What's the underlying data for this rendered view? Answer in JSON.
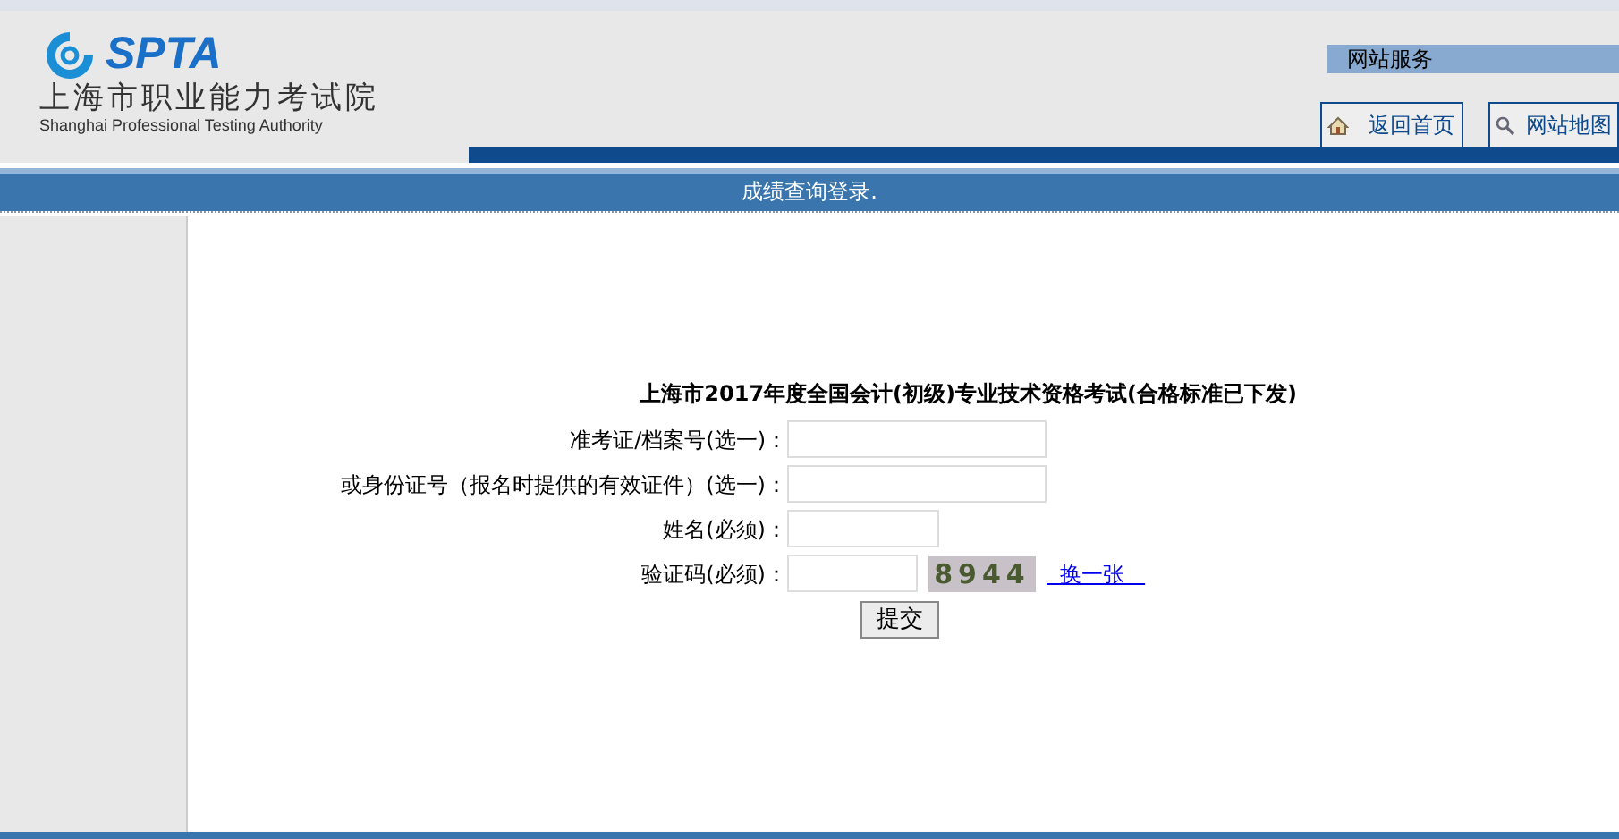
{
  "logo": {
    "mark": "SPTA",
    "name": "上海市职业能力考试院",
    "english": "Shanghai Professional Testing Authority"
  },
  "services": {
    "title": "网站服务",
    "links": [
      {
        "kind": "home",
        "label": "返回首页"
      },
      {
        "kind": "search",
        "label": "网站地图"
      }
    ]
  },
  "banner": "成绩查询登录.",
  "form": {
    "title": "上海市2017年度全国会计(初级)专业技术资格考试(合格标准已下发)",
    "fields": [
      {
        "label": "准考证/档案号(选一)：",
        "kind": "wide"
      },
      {
        "label": "或身份证号（报名时提供的有效证件）(选一)：",
        "kind": "wide"
      },
      {
        "label": "姓名(必须)：",
        "kind": "narrow"
      },
      {
        "label": "验证码(必须)：",
        "kind": "captcha"
      }
    ],
    "captcha": "8944",
    "refresh": "换一张",
    "submit": "提交"
  }
}
